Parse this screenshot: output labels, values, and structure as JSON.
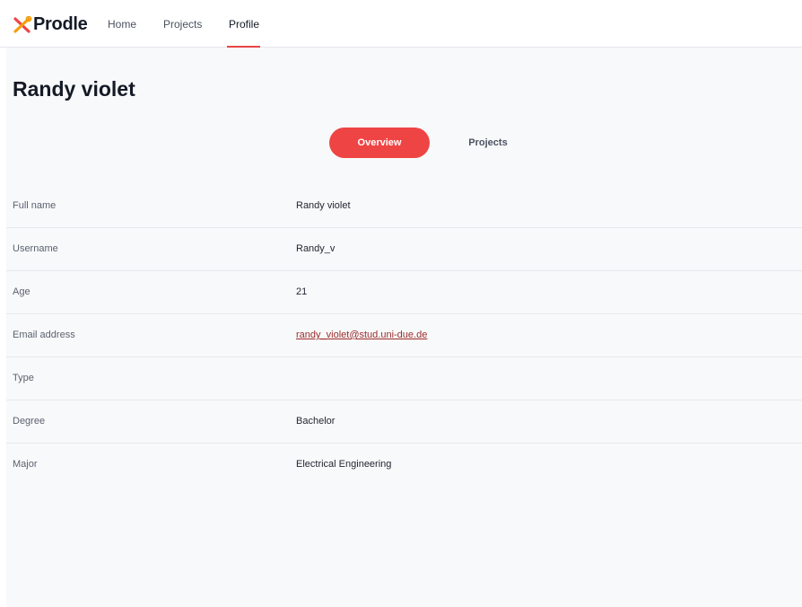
{
  "brand": {
    "name": "Prodle",
    "logo_icon": "tools-cross-icon",
    "colors": {
      "orange": "#f59e0b",
      "red": "#ef4444"
    }
  },
  "nav": {
    "items": [
      {
        "label": "Home"
      },
      {
        "label": "Projects"
      },
      {
        "label": "Profile"
      }
    ],
    "active": "Profile"
  },
  "page": {
    "title": "Randy violet"
  },
  "tabs": {
    "items": [
      {
        "label": "Overview"
      },
      {
        "label": "Projects"
      }
    ],
    "active": "Overview"
  },
  "profile": {
    "rows": [
      {
        "label": "Full name",
        "value": "Randy violet"
      },
      {
        "label": "Username",
        "value": "Randy_v"
      },
      {
        "label": "Age",
        "value": "21"
      },
      {
        "label": "Email address",
        "value": "randy_violet@stud.uni-due.de"
      },
      {
        "label": "Type",
        "value": ""
      },
      {
        "label": "Degree",
        "value": "Bachelor"
      },
      {
        "label": "Major",
        "value": "Electrical Engineering"
      }
    ]
  },
  "colors": {
    "accent": "#ef4444",
    "link": "#9b2c2c",
    "content_bg": "#f8f9fa"
  }
}
